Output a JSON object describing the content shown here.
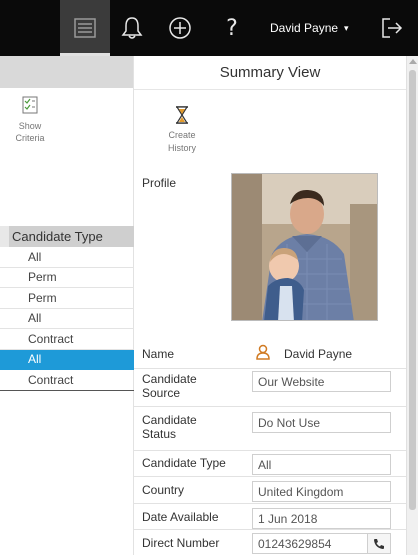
{
  "topbar": {
    "user_name": "David Payne",
    "user_caret": "▾",
    "help_glyph": "?",
    "icons": [
      "list-icon",
      "bell-icon",
      "add-circle-icon",
      "help-icon",
      "logout-icon"
    ],
    "background": "#0a0a0a"
  },
  "sidebar": {
    "show_criteria_label_1": "Show",
    "show_criteria_label_2": "Criteria",
    "candidate_type": {
      "header": "Candidate Type",
      "items": [
        {
          "label": "All",
          "selected": false
        },
        {
          "label": "Perm",
          "selected": false
        },
        {
          "label": "Perm",
          "selected": false
        },
        {
          "label": "All",
          "selected": false
        },
        {
          "label": "Contract",
          "selected": false
        },
        {
          "label": "All",
          "selected": true
        },
        {
          "label": "Contract",
          "selected": false
        }
      ],
      "selected_color": "#1e9ad8"
    }
  },
  "main": {
    "title": "Summary View",
    "create_history_label_1": "Create",
    "create_history_label_2": "History",
    "profile_label": "Profile",
    "fields": {
      "name": {
        "label": "Name",
        "value": "David Payne"
      },
      "candidate_source": {
        "label_1": "Candidate",
        "label_2": "Source",
        "value": "Our Website"
      },
      "candidate_status": {
        "label_1": "Candidate",
        "label_2": "Status",
        "value": "Do Not Use"
      },
      "candidate_type": {
        "label": "Candidate Type",
        "value": "All"
      },
      "country": {
        "label": "Country",
        "value": "United Kingdom"
      },
      "date_available": {
        "label": "Date Available",
        "value": "1 Jun 2018"
      },
      "direct_number": {
        "label": "Direct Number",
        "value": "01243629854"
      }
    }
  }
}
